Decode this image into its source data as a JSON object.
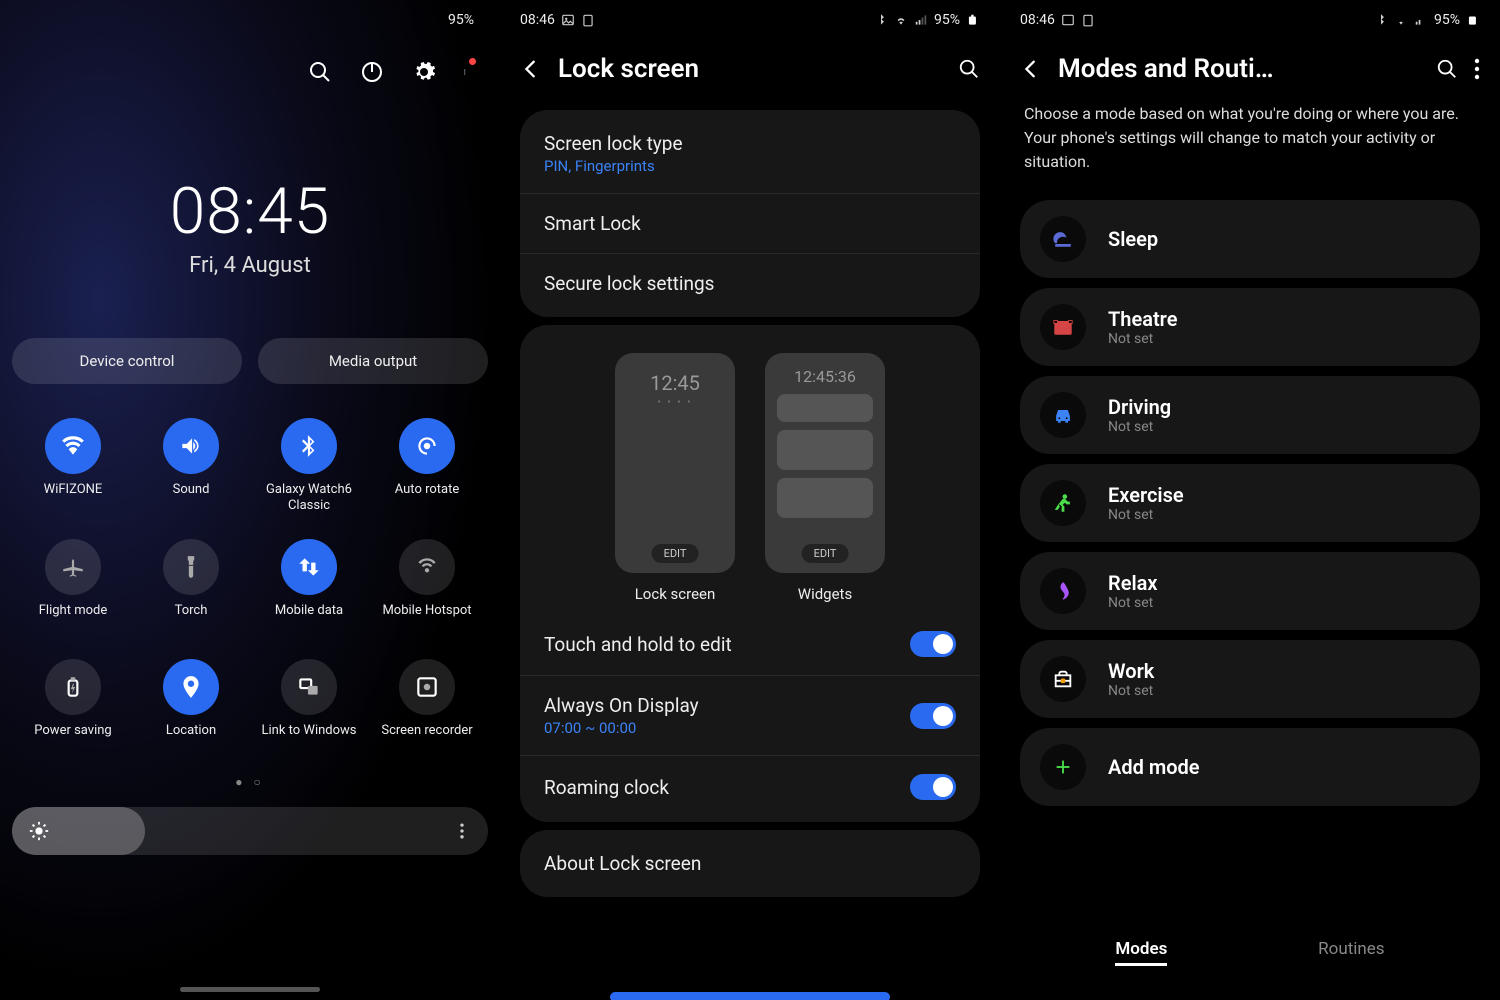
{
  "status": {
    "time": "08:46",
    "battery": "95%"
  },
  "panel1": {
    "clock": "08:45",
    "date": "Fri, 4 August",
    "chips": [
      "Device control",
      "Media output"
    ],
    "tiles": [
      {
        "label": "WiFIZONE",
        "icon": "wifi",
        "on": true
      },
      {
        "label": "Sound",
        "icon": "sound",
        "on": true
      },
      {
        "label": "Galaxy Watch6 Classic",
        "icon": "bluetooth",
        "on": true
      },
      {
        "label": "Auto rotate",
        "icon": "rotate",
        "on": true
      },
      {
        "label": "Flight mode",
        "icon": "plane",
        "on": false
      },
      {
        "label": "Torch",
        "icon": "torch",
        "on": false
      },
      {
        "label": "Mobile data",
        "icon": "data",
        "on": true
      },
      {
        "label": "Mobile Hotspot",
        "icon": "hotspot",
        "on": false
      },
      {
        "label": "Power saving",
        "icon": "battery",
        "on": false
      },
      {
        "label": "Location",
        "icon": "location",
        "on": true
      },
      {
        "label": "Link to Windows",
        "icon": "link",
        "on": false
      },
      {
        "label": "Screen recorder",
        "icon": "record",
        "on": false
      }
    ]
  },
  "panel2": {
    "title": "Lock screen",
    "screen_lock_type": {
      "title": "Screen lock type",
      "sub": "PIN, Fingerprints"
    },
    "smart_lock": "Smart Lock",
    "secure_lock": "Secure lock settings",
    "preview_lock": {
      "time": "12:45",
      "edit": "EDIT",
      "label": "Lock screen"
    },
    "preview_widgets": {
      "time": "12:45:36",
      "edit": "EDIT",
      "label": "Widgets"
    },
    "touch_hold": "Touch and hold to edit",
    "aod": {
      "title": "Always On Display",
      "sub": "07:00 ~ 00:00"
    },
    "roaming": "Roaming clock",
    "about": "About Lock screen"
  },
  "panel3": {
    "title": "Modes and Routi…",
    "desc": "Choose a mode based on what you're doing or where you are. Your phone's settings will change to match your activity or situation.",
    "modes": [
      {
        "title": "Sleep",
        "sub": "",
        "icon": "sleep",
        "color": "#5b6bd6"
      },
      {
        "title": "Theatre",
        "sub": "Not set",
        "icon": "theatre",
        "color": "#d64545"
      },
      {
        "title": "Driving",
        "sub": "Not set",
        "icon": "driving",
        "color": "#3b82f6"
      },
      {
        "title": "Exercise",
        "sub": "Not set",
        "icon": "exercise",
        "color": "#4ade4a"
      },
      {
        "title": "Relax",
        "sub": "Not set",
        "icon": "relax",
        "color": "#a855f7"
      },
      {
        "title": "Work",
        "sub": "Not set",
        "icon": "work",
        "color": "#f59e0b"
      }
    ],
    "add_mode": "Add mode",
    "tabs": [
      "Modes",
      "Routines"
    ]
  }
}
